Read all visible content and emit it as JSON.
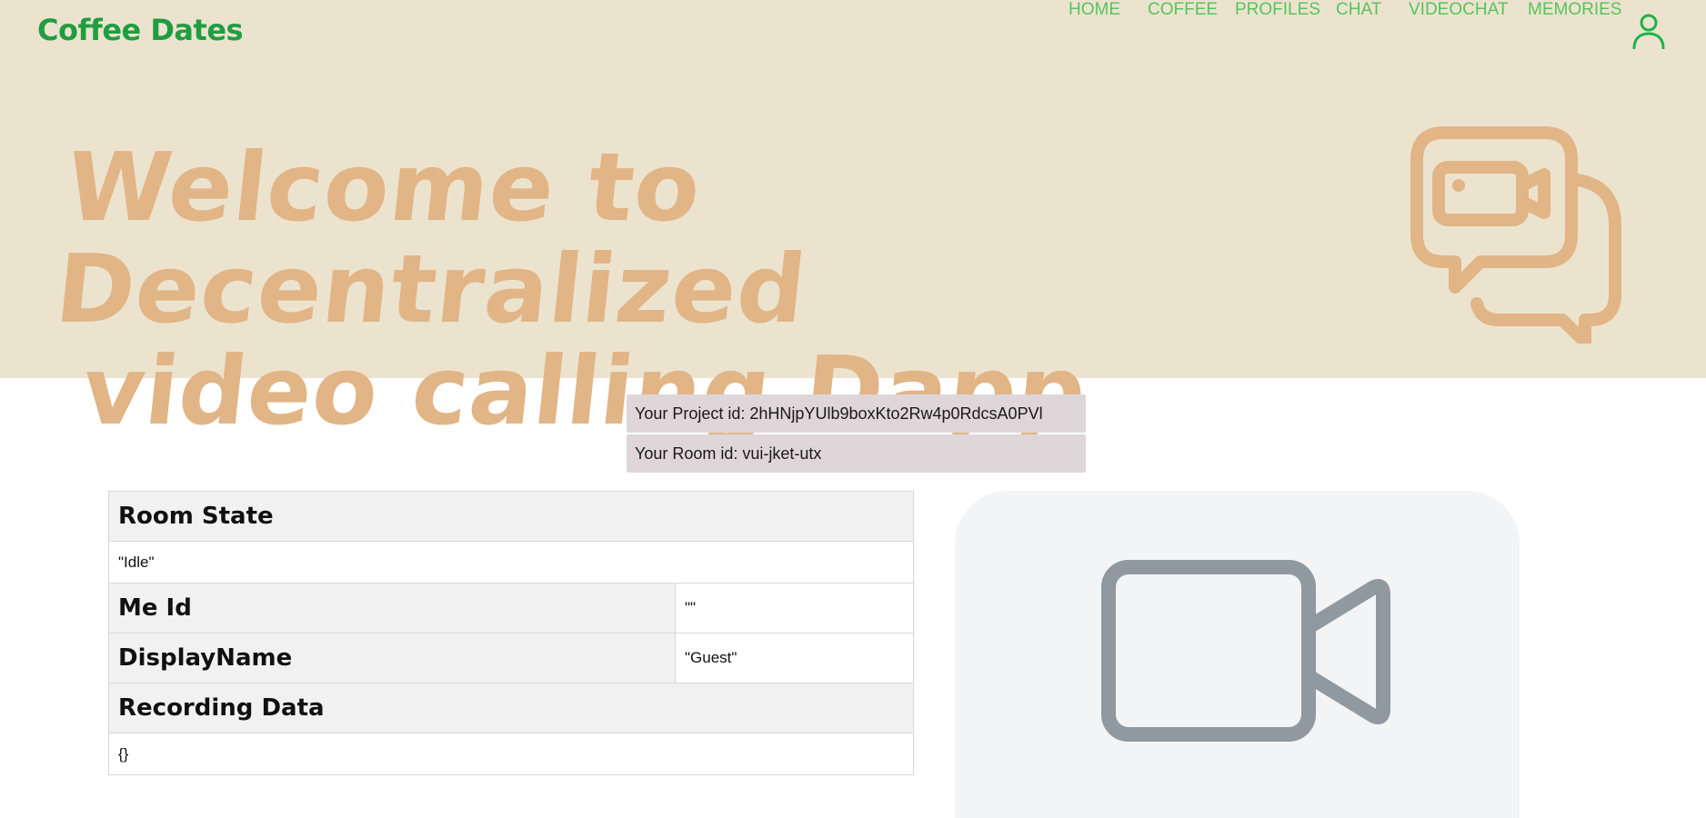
{
  "header": {
    "brand": "Coffee Dates",
    "nav": [
      "HOME",
      "COFFEE",
      "PROFILES",
      "CHAT",
      "VIDEOCHAT",
      "MEMORIES"
    ],
    "user_icon": "user-icon"
  },
  "hero": {
    "line1": "Welcome to Decentralized",
    "line2": "video calling Dapp",
    "icon": "video-chat-bubble-icon",
    "color": "#e1b586",
    "background": "#ece3cf"
  },
  "info": {
    "project": "Your Project id: 2hHNjpYUlb9boxKto2Rw4p0RdcsA0PVl",
    "room": "Your Room id: vui-jket-utx"
  },
  "state_table": {
    "room_state_label": "Room State",
    "room_state_value": "\"Idle\"",
    "me_id_label": "Me Id",
    "me_id_value": "\"\"",
    "display_name_label": "DisplayName",
    "display_name_value": "\"Guest\"",
    "recording_label": "Recording Data",
    "recording_value": "{}"
  },
  "video": {
    "icon": "video-camera-icon",
    "color": "#8f999f"
  },
  "colors": {
    "brand": "#1f9e41",
    "nav": "#57c45d"
  }
}
